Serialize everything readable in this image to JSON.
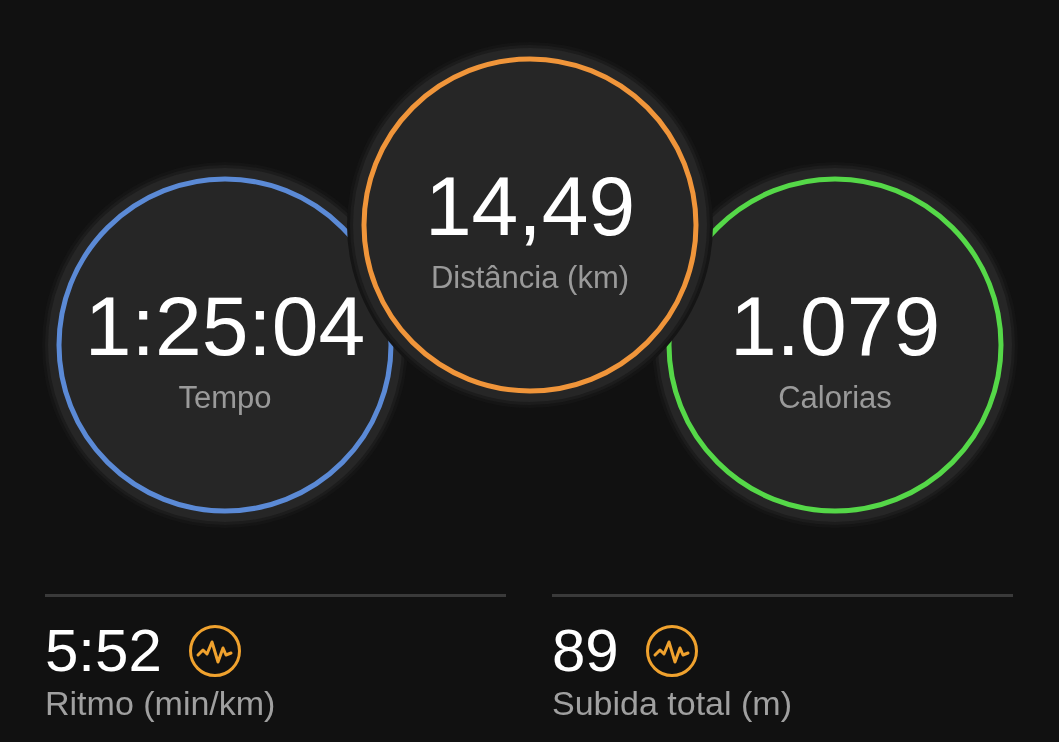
{
  "circles": [
    {
      "value": "1:25:04",
      "label": "Tempo",
      "color": "#5b8ad6"
    },
    {
      "value": "14,49",
      "label": "Distância (km)",
      "color": "#f0953a"
    },
    {
      "value": "1.079",
      "label": "Calorias",
      "color": "#55d848"
    }
  ],
  "stats": [
    {
      "value": "5:52",
      "label": "Ritmo (min/km)"
    },
    {
      "value": "89",
      "label": "Subida total (m)"
    }
  ]
}
